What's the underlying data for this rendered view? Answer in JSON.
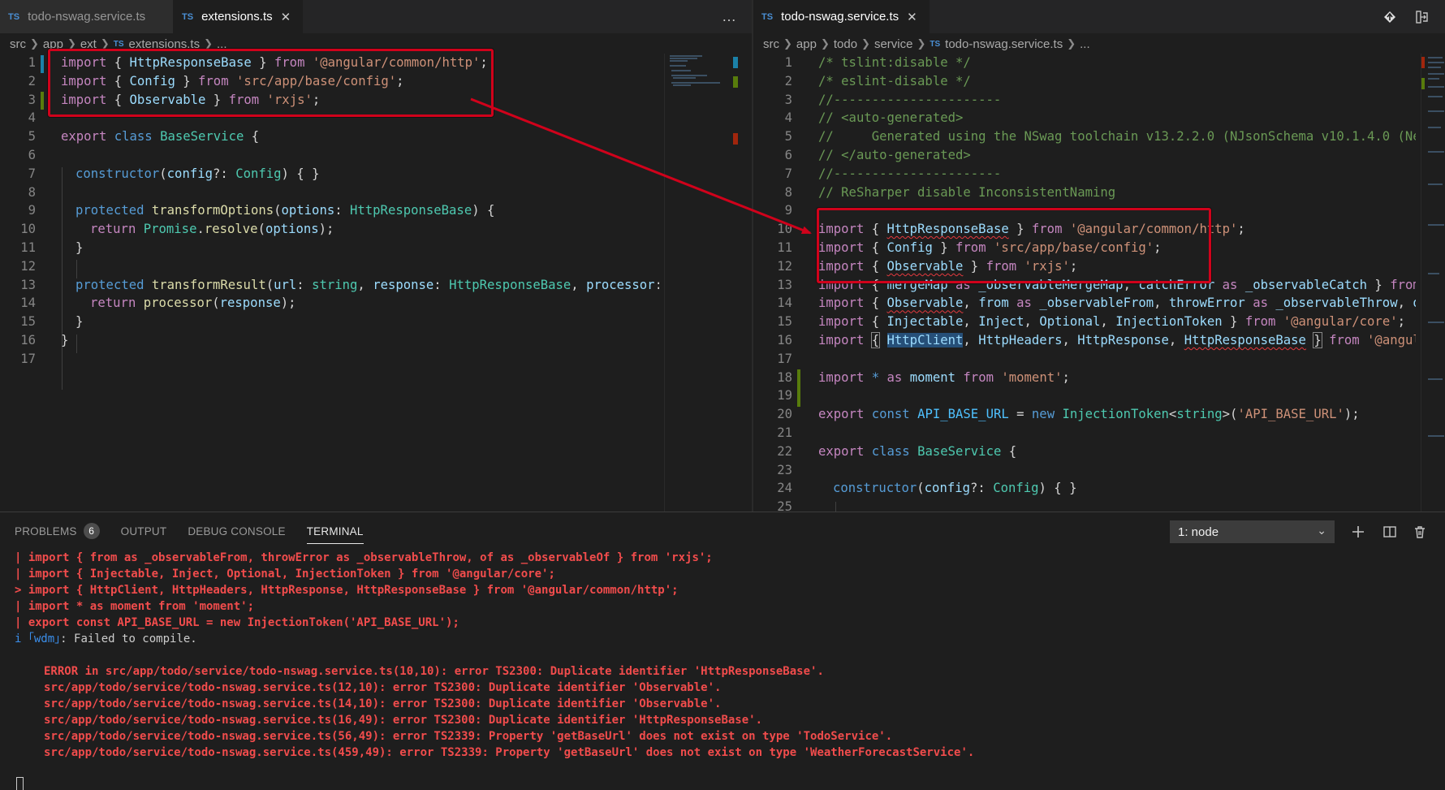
{
  "left_editor": {
    "tabs": [
      {
        "label": "todo-nswag.service.ts",
        "active": false,
        "lang": "TS"
      },
      {
        "label": "extensions.ts",
        "active": true,
        "lang": "TS"
      }
    ],
    "more_icon": "…",
    "breadcrumb": [
      "src",
      "app",
      "ext",
      "extensions.ts",
      "..."
    ],
    "line_numbers": [
      "1",
      "2",
      "3",
      "4",
      "5",
      "6",
      "7",
      "8",
      "9",
      "10",
      "11",
      "12",
      "13",
      "14",
      "15",
      "16",
      "17"
    ]
  },
  "right_editor": {
    "tabs": [
      {
        "label": "todo-nswag.service.ts",
        "active": true,
        "lang": "TS"
      }
    ],
    "breadcrumb": [
      "src",
      "app",
      "todo",
      "service",
      "todo-nswag.service.ts",
      "..."
    ],
    "line_numbers": [
      "1",
      "2",
      "3",
      "4",
      "5",
      "6",
      "7",
      "8",
      "9",
      "10",
      "11",
      "12",
      "13",
      "14",
      "15",
      "16",
      "17",
      "18",
      "19",
      "20",
      "21",
      "22",
      "23",
      "24",
      "25"
    ]
  },
  "panel": {
    "tabs": [
      "PROBLEMS",
      "OUTPUT",
      "DEBUG CONSOLE",
      "TERMINAL"
    ],
    "problems_count": "6",
    "terminal_select": "1: node",
    "terminal_lines": [
      "| import { from as _observableFrom, throwError as _observableThrow, of as _observableOf } from 'rxjs';",
      "| import { Injectable, Inject, Optional, InjectionToken } from '@angular/core';",
      "> import { HttpClient, HttpHeaders, HttpResponse, HttpResponseBase } from '@angular/common/http';",
      "| import * as moment from 'moment';",
      "| export const API_BASE_URL = new InjectionToken('API_BASE_URL');"
    ],
    "wdm_prefix": "i ｢wdm｣",
    "wdm_message": ": Failed to compile.",
    "errors": [
      "ERROR in src/app/todo/service/todo-nswag.service.ts(10,10): error TS2300: Duplicate identifier 'HttpResponseBase'.",
      "src/app/todo/service/todo-nswag.service.ts(12,10): error TS2300: Duplicate identifier 'Observable'.",
      "src/app/todo/service/todo-nswag.service.ts(14,10): error TS2300: Duplicate identifier 'Observable'.",
      "src/app/todo/service/todo-nswag.service.ts(16,49): error TS2300: Duplicate identifier 'HttpResponseBase'.",
      "src/app/todo/service/todo-nswag.service.ts(56,49): error TS2339: Property 'getBaseUrl' does not exist on type 'TodoService'.",
      "src/app/todo/service/todo-nswag.service.ts(459,49): error TS2339: Property 'getBaseUrl' does not exist on type 'WeatherForecastService'."
    ]
  },
  "icons": {
    "left_more": "more-actions-icon",
    "right_split": "open-changes-icon",
    "right_compare": "split-editor-icon",
    "panel_add": "plus-icon",
    "panel_split": "split-terminal-icon",
    "panel_trash": "trash-icon",
    "select_chevron": "chevron-down-icon"
  },
  "colors": {
    "annotation": "#d0021b",
    "keyword": "#569cd6",
    "string": "#ce9178",
    "type": "#4ec9b0",
    "error": "#f14c4c"
  }
}
